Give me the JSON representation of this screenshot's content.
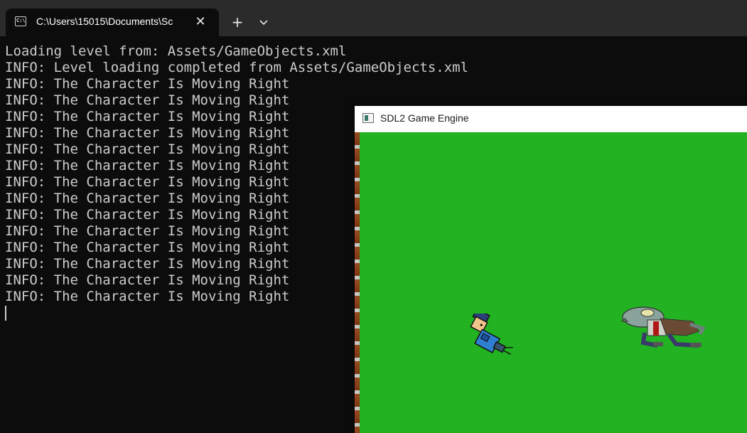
{
  "terminal": {
    "tab_title": "C:\\Users\\15015\\Documents\\Sc",
    "tab_icon": "C:\\",
    "close_symbol": "✕",
    "new_tab_symbol": "+",
    "lines": [
      "Loading level from: Assets/GameObjects.xml",
      "INFO: Level loading completed from Assets/GameObjects.xml",
      "INFO: The Character Is Moving Right",
      "INFO: The Character Is Moving Right",
      "INFO: The Character Is Moving Right",
      "INFO: The Character Is Moving Right",
      "INFO: The Character Is Moving Right",
      "INFO: The Character Is Moving Right",
      "INFO: The Character Is Moving Right",
      "INFO: The Character Is Moving Right",
      "INFO: The Character Is Moving Right",
      "INFO: The Character Is Moving Right",
      "INFO: The Character Is Moving Right",
      "INFO: The Character Is Moving Right",
      "INFO: The Character Is Moving Right",
      "INFO: The Character Is Moving Right"
    ]
  },
  "game_window": {
    "title": "SDL2 Game Engine",
    "canvas_color": "#22b222"
  },
  "sprites": {
    "player": "player-character-sprite",
    "enemy": "zombie-enemy-sprite"
  }
}
